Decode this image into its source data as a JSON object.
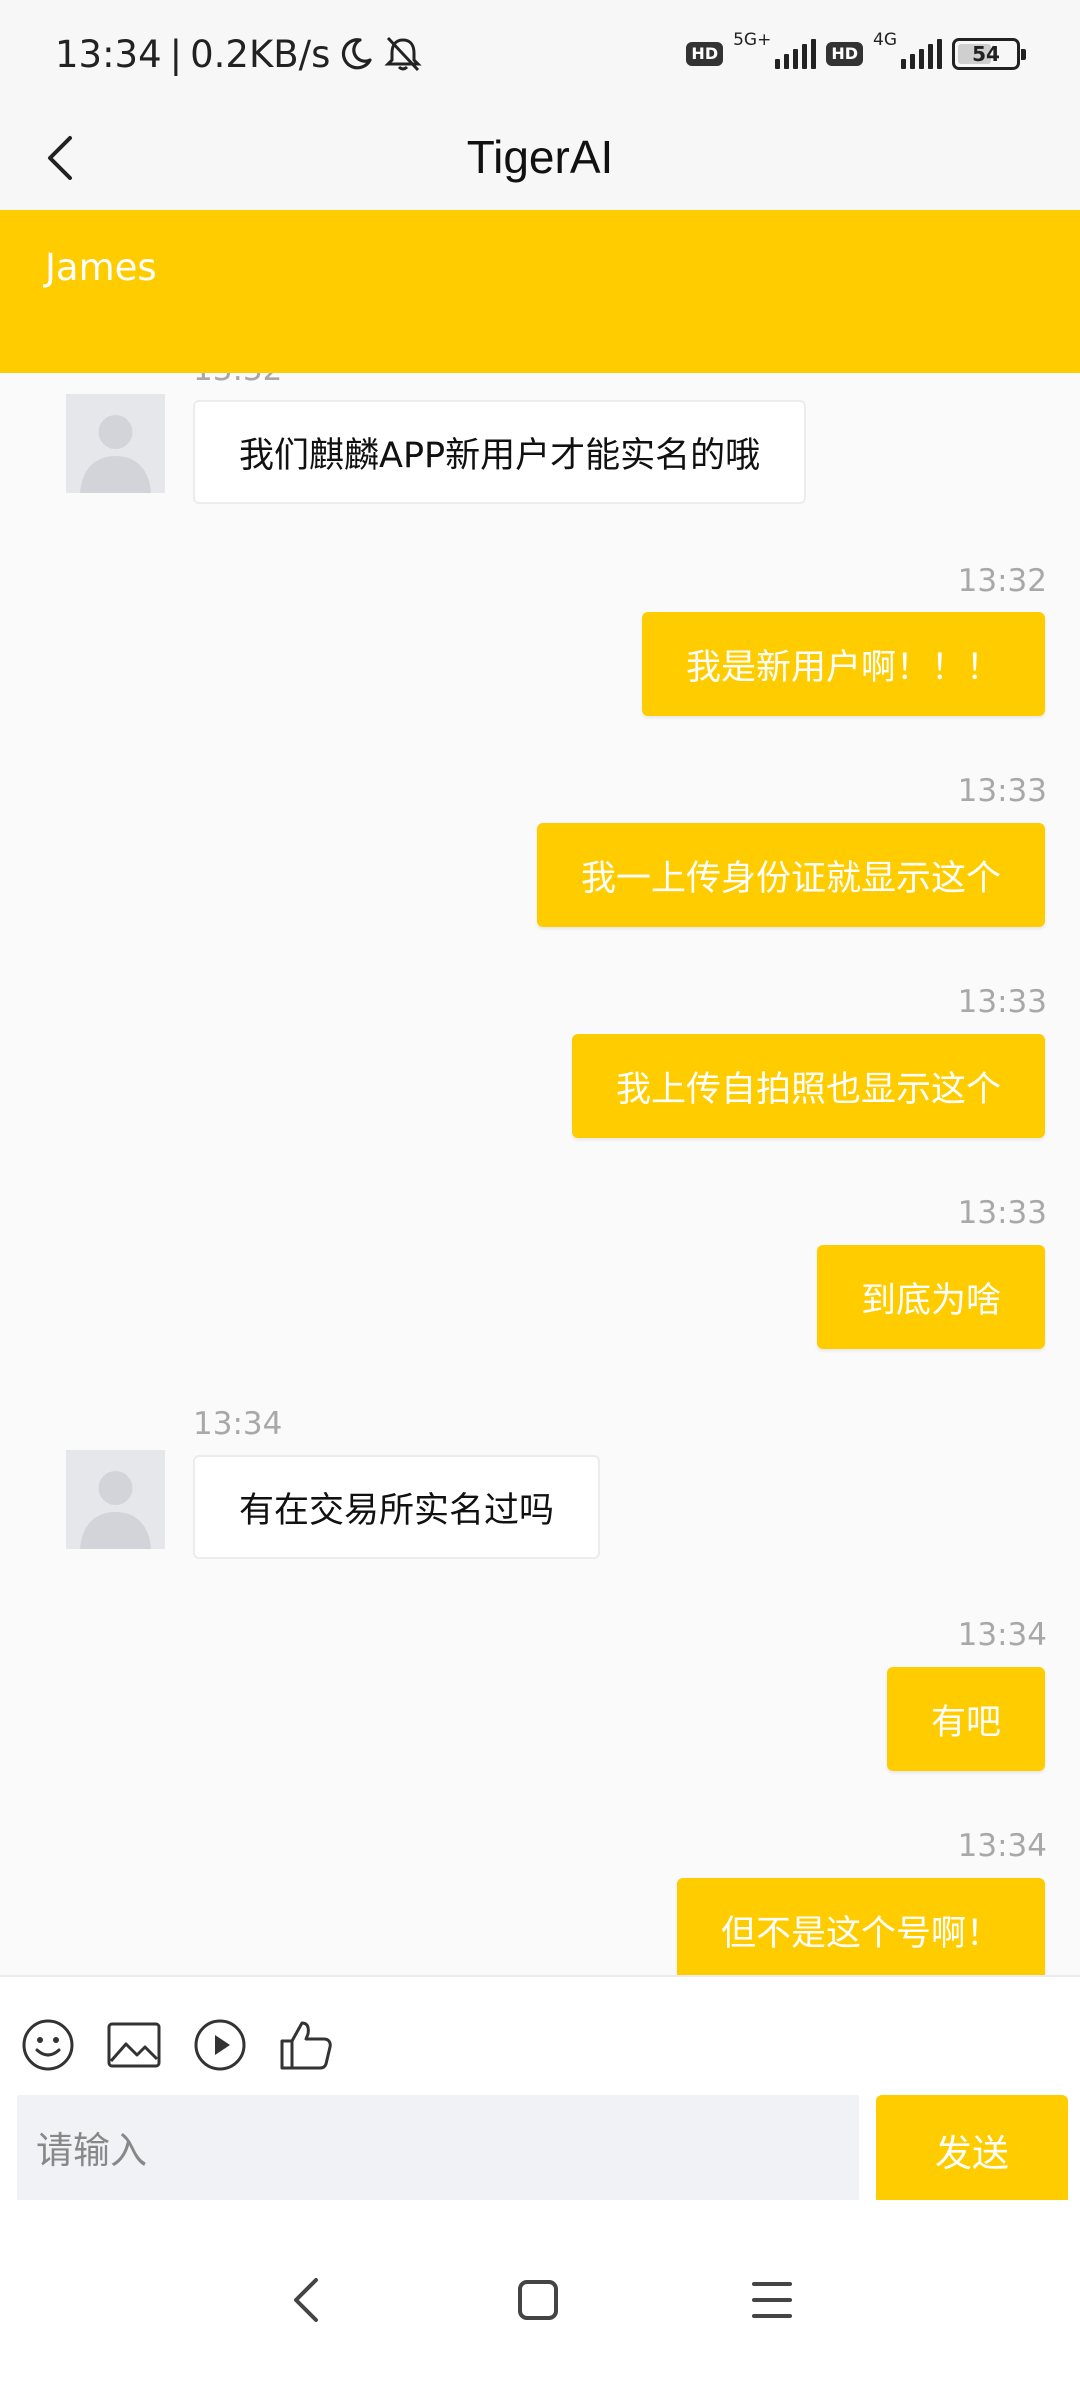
{
  "status_bar": {
    "time": "13:34",
    "separator": "|",
    "net_speed": "0.2KB/s",
    "sim1_badge": "HD",
    "sim1_network": "5G+",
    "sim2_badge": "HD",
    "sim2_network": "4G",
    "battery_level": "54",
    "battery_fraction": 0.54
  },
  "header": {
    "title": "TigerAI"
  },
  "banner": {
    "name": "James",
    "color": "#ffcc00"
  },
  "messages": [
    {
      "side": "in",
      "time": "13:32",
      "text": "我们麒麟APP新用户才能实名的哦"
    },
    {
      "side": "out",
      "time": "13:32",
      "text": "我是新用户啊！！！"
    },
    {
      "side": "out",
      "time": "13:33",
      "text": "我一上传身份证就显示这个"
    },
    {
      "side": "out",
      "time": "13:33",
      "text": "我上传自拍照也显示这个"
    },
    {
      "side": "out",
      "time": "13:33",
      "text": "到底为啥"
    },
    {
      "side": "in",
      "time": "13:34",
      "text": "有在交易所实名过吗"
    },
    {
      "side": "out",
      "time": "13:34",
      "text": "有吧"
    },
    {
      "side": "out",
      "time": "13:34",
      "text": "但不是这个号啊！"
    }
  ],
  "composer": {
    "tools": [
      "emoji-icon",
      "image-icon",
      "video-icon",
      "thumbs-up-icon"
    ],
    "placeholder": "请输入",
    "value": "",
    "send_label": "发送"
  },
  "system_nav": [
    "back-icon",
    "home-icon",
    "menu-icon"
  ],
  "colors": {
    "accent": "#ffcc00",
    "background": "#fafafa",
    "timestamp": "#a8a8a8"
  }
}
